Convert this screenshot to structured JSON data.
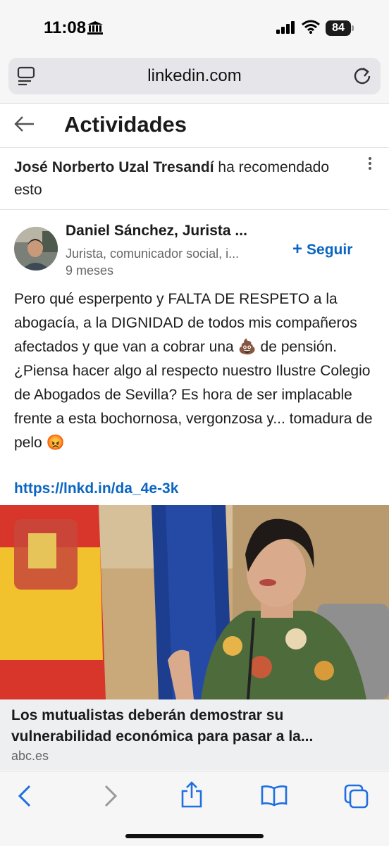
{
  "status": {
    "time": "11:08",
    "battery": "84"
  },
  "browser": {
    "url": "linkedin.com"
  },
  "header": {
    "title": "Actividades"
  },
  "activity": {
    "actor": "José Norberto Uzal Tresandí",
    "action": " ha recomendado esto"
  },
  "author": {
    "name": "Daniel Sánchez, Jurista ...",
    "headline": "Jurista, comunicador social, i...",
    "time": "9 meses",
    "follow_label": "Seguir"
  },
  "post": {
    "text": "Pero qué esperpento y FALTA DE RESPETO a la abogacía, a la DIGNIDAD de todos mis compañeros afectados y que van a cobrar una 💩 de pensión. ¿Piensa hacer algo al respecto nuestro Ilustre Colegio de Abogados de Sevilla? Es hora de ser implacable frente a esta bochornosa, vergonzosa y... tomadura de pelo 😡",
    "link": "https://lnkd.in/da_4e-3k"
  },
  "article": {
    "title": "Los mutualistas deberán demostrar su vulnerabilidad económica para pasar a la...",
    "source": "abc.es"
  },
  "icons": {
    "bank": "bank-icon",
    "signal": "signal-icon",
    "wifi": "wifi-icon",
    "reader": "reader-icon",
    "reload": "reload-icon",
    "back": "back-arrow-icon",
    "more": "more-vertical-icon",
    "toolbar": [
      "back-icon",
      "forward-icon",
      "share-icon",
      "bookmarks-icon",
      "tabs-icon"
    ]
  },
  "colors": {
    "link": "#0a66c2",
    "accent": "#0a66c2"
  }
}
